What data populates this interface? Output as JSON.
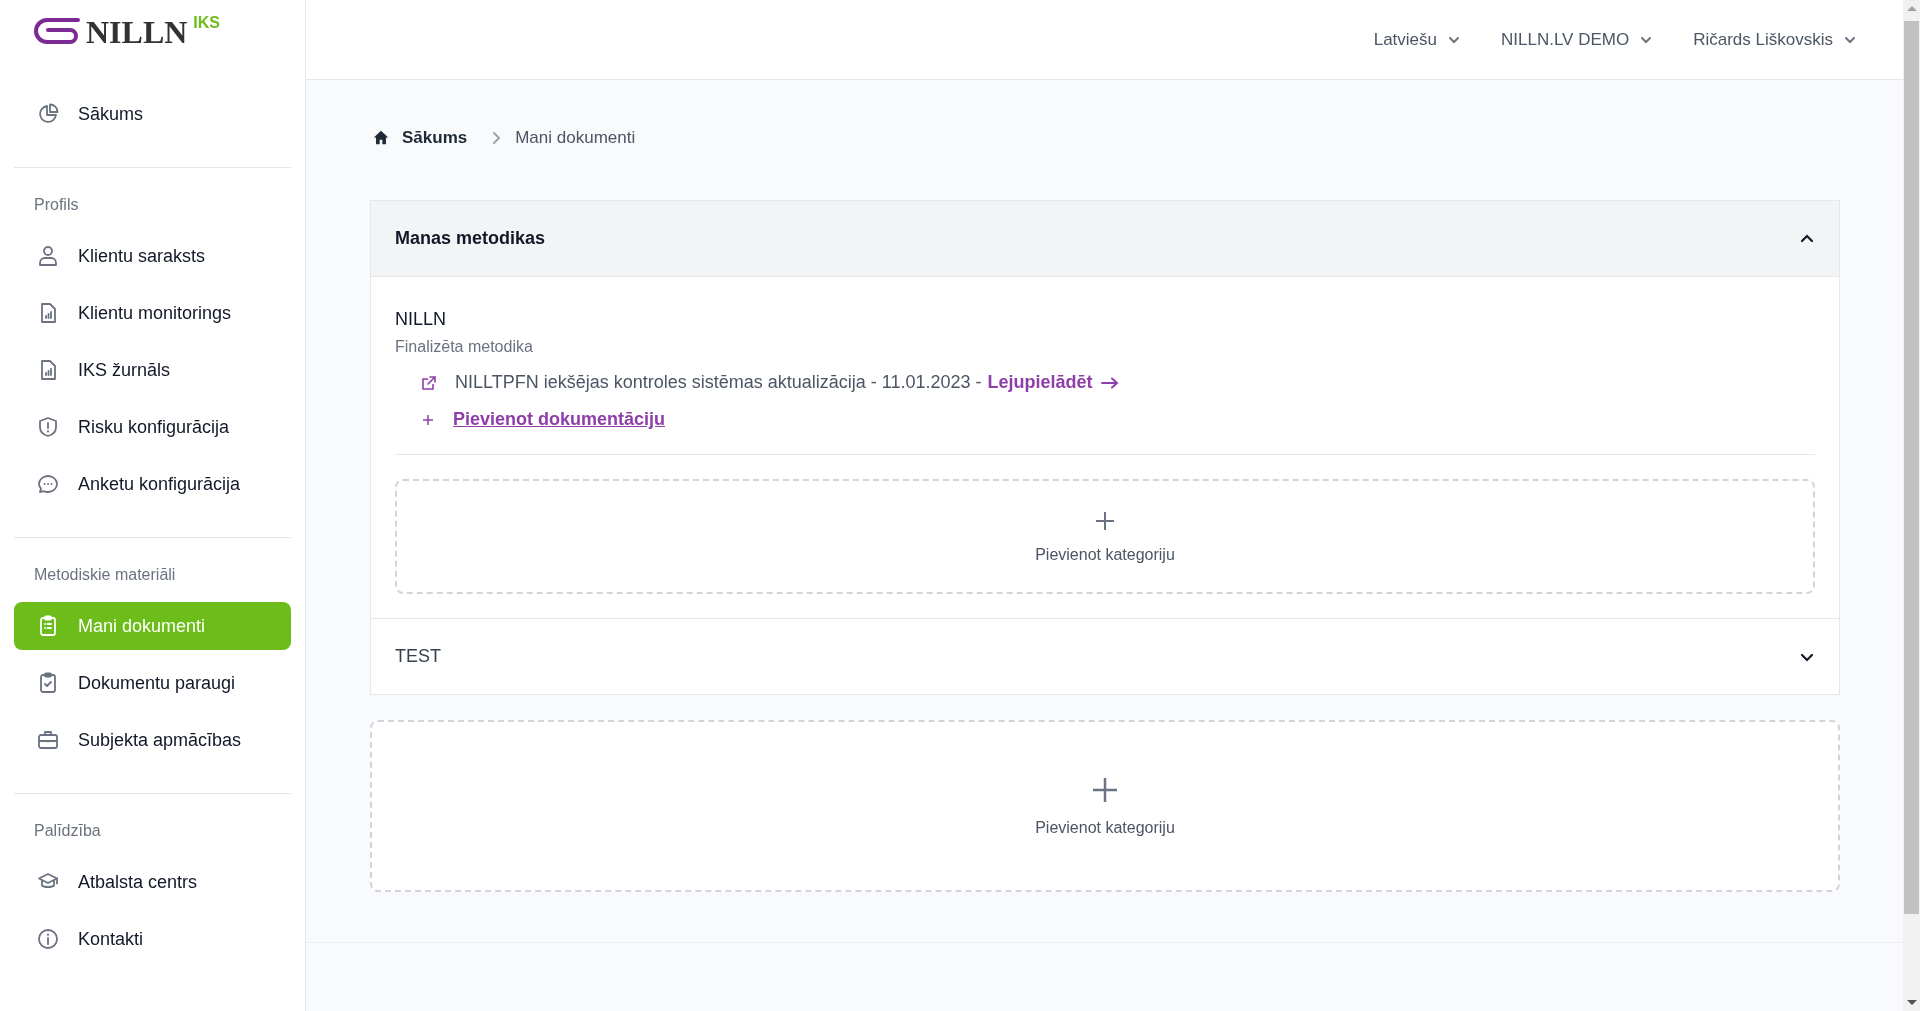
{
  "logo": {
    "text": "NILLN",
    "badge": "IKS"
  },
  "sidebar": {
    "sections": [
      {
        "items": [
          {
            "label": "Sākums",
            "selected": false
          }
        ]
      },
      {
        "heading": "Profils",
        "items": [
          {
            "label": "Klientu saraksts",
            "selected": false
          },
          {
            "label": "Klientu monitorings",
            "selected": false
          },
          {
            "label": "IKS žurnāls",
            "selected": false
          },
          {
            "label": "Risku konfigurācija",
            "selected": false
          },
          {
            "label": "Anketu konfigurācija",
            "selected": false
          }
        ]
      },
      {
        "heading": "Metodiskie materiāli",
        "items": [
          {
            "label": "Mani dokumenti",
            "selected": true
          },
          {
            "label": "Dokumentu paraugi",
            "selected": false
          },
          {
            "label": "Subjekta apmācības",
            "selected": false
          }
        ]
      },
      {
        "heading": "Palīdzība",
        "items": [
          {
            "label": "Atbalsta centrs",
            "selected": false
          },
          {
            "label": "Kontakti",
            "selected": false
          }
        ]
      }
    ]
  },
  "header": {
    "menus": [
      "Latviešu",
      "NILLN.LV DEMO",
      "Ričards Liškovskis"
    ]
  },
  "breadcrumb": [
    "Sākums",
    "Mani dokumenti"
  ],
  "categories": [
    {
      "title": "Manas metodikas",
      "expanded": true,
      "methods": [
        {
          "name": "NILLN",
          "status": "Finalizēta metodika",
          "documents": [
            {
              "text": "NILLTPFN iekšējas kontroles sistēmas aktualizācija - 11.01.2023 -",
              "link": "Lejupielādēt"
            }
          ],
          "add_link": "Pievienot dokumentāciju"
        }
      ],
      "add_category": "Pievienot kategoriju"
    },
    {
      "title": "TEST",
      "expanded": false
    }
  ],
  "add_category": "Pievienot kategoriju"
}
